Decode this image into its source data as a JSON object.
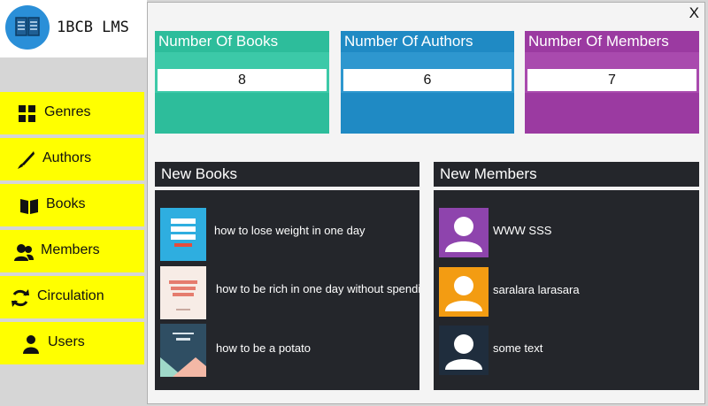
{
  "app": {
    "title": "1BCB LMS",
    "close_label": "X"
  },
  "sidebar": {
    "items": [
      {
        "label": "Genres",
        "icon": "grid-icon"
      },
      {
        "label": "Authors",
        "icon": "pen-icon"
      },
      {
        "label": "Books",
        "icon": "book-open-icon"
      },
      {
        "label": "Members",
        "icon": "users-icon"
      },
      {
        "label": "Circulation",
        "icon": "refresh-icon"
      },
      {
        "label": "Users",
        "icon": "user-icon"
      }
    ]
  },
  "stats": {
    "books": {
      "title": "Number Of Books",
      "value": "8",
      "color": "#2dbd9b",
      "band": "#3cc9a8"
    },
    "authors": {
      "title": "Number Of Authors",
      "value": "6",
      "color": "#1f8ac4",
      "band": "#2e97cf"
    },
    "members": {
      "title": "Number Of Members",
      "value": "7",
      "color": "#9b3aa1",
      "band": "#a94aae"
    }
  },
  "new_books": {
    "heading": "New Books",
    "items": [
      {
        "title": "how to lose weight in one day"
      },
      {
        "title": "how to be rich in one day without spending"
      },
      {
        "title": "how to be a potato"
      }
    ]
  },
  "new_members": {
    "heading": "New Members",
    "items": [
      {
        "name": "WWW SSS",
        "color": "#8e44ad"
      },
      {
        "name": "saralara larasara",
        "color": "#f39c12"
      },
      {
        "name": "some text",
        "color": "#1f2d3d"
      }
    ]
  },
  "colors": {
    "nav_bg": "#ffff00",
    "panel_bg": "#24262b",
    "logo": "#2a8fd8"
  }
}
